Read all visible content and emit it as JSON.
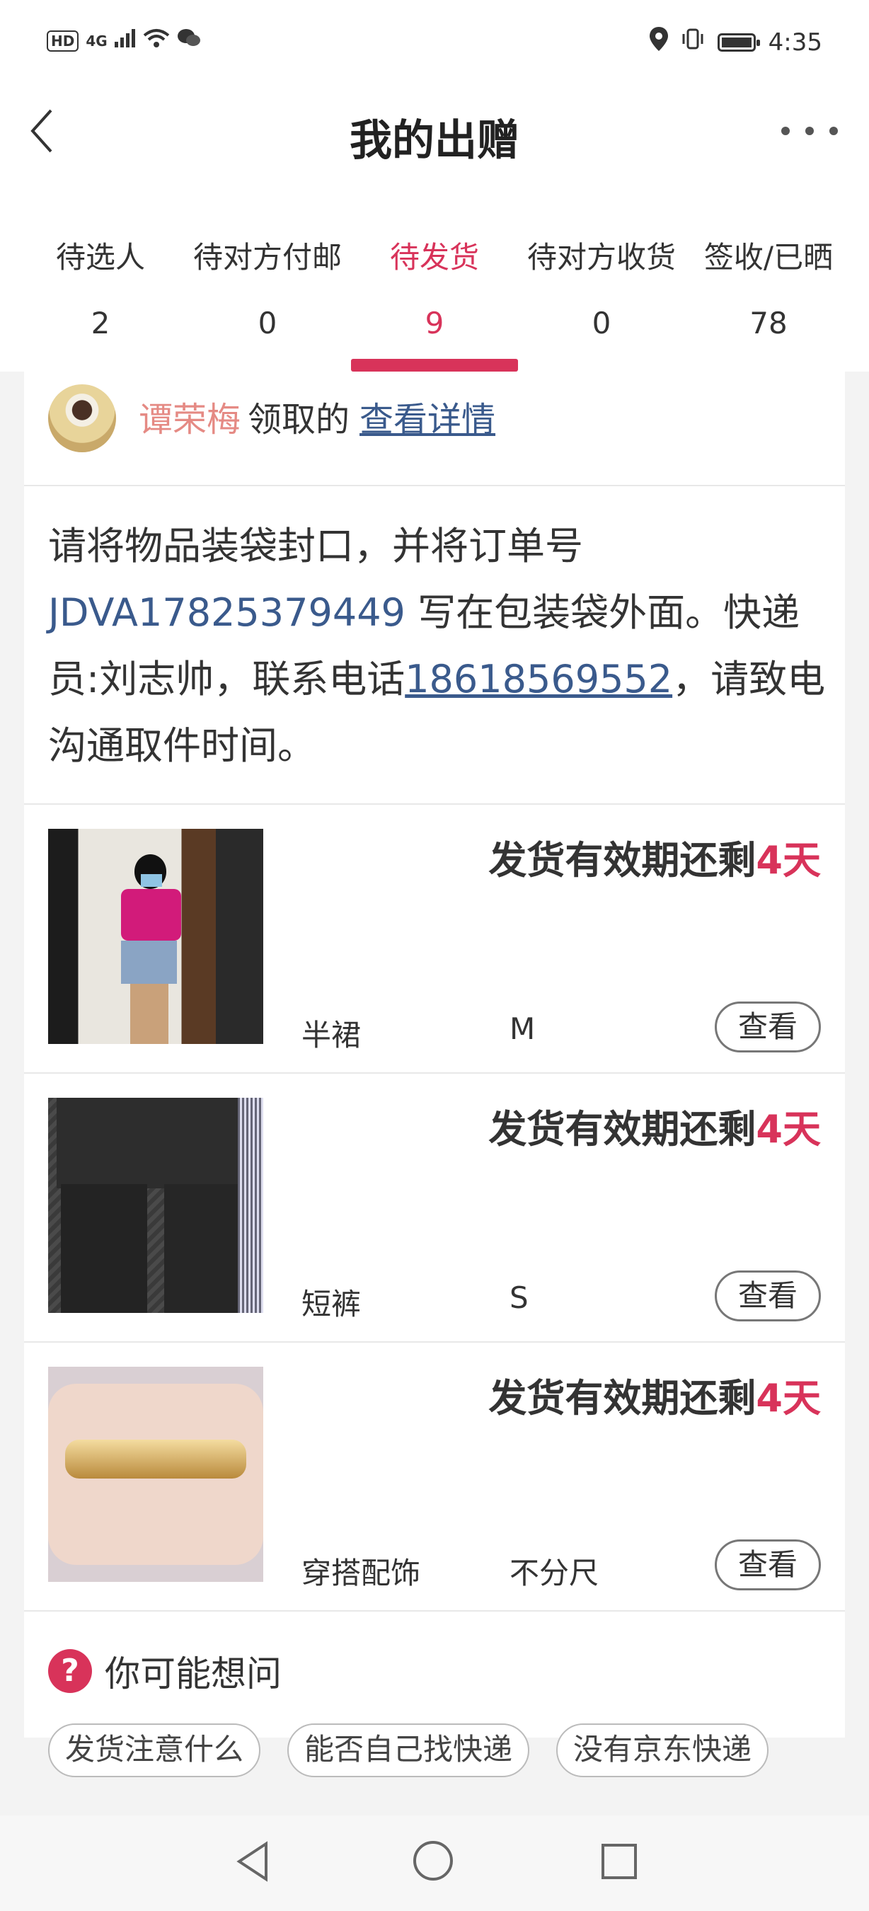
{
  "status_bar": {
    "network_hd": "HD",
    "signal": "4G",
    "time": "4:35",
    "icons": [
      "wifi-icon",
      "wechat-icon",
      "location-icon",
      "vibrate-icon",
      "battery-icon"
    ]
  },
  "header": {
    "title": "我的出赠",
    "back_icon": "chevron-left-icon",
    "more_icon": "more-dots-icon"
  },
  "tabs": [
    {
      "label": "待选人",
      "count": "2",
      "active": false
    },
    {
      "label": "待对方付邮",
      "count": "0",
      "active": false
    },
    {
      "label": "待发货",
      "count": "9",
      "active": true
    },
    {
      "label": "待对方收货",
      "count": "0",
      "active": false
    },
    {
      "label": "签收/已晒",
      "count": "78",
      "active": false
    }
  ],
  "receiver": {
    "name": "谭荣梅",
    "action": "领取的",
    "details_link": "查看详情"
  },
  "instruction": {
    "part1": "请将物品装袋封口，并将订单号 ",
    "order_no": "JDVA17825379449",
    "part2": " 写在包装袋外面。快递员:刘志帅，联系电话",
    "phone": "18618569552",
    "part3": "，请致电沟通取件时间。"
  },
  "items": [
    {
      "deadline_text": "发货有效期还剩",
      "days": "4天",
      "category": "半裙",
      "size": "M",
      "view_label": "查看"
    },
    {
      "deadline_text": "发货有效期还剩",
      "days": "4天",
      "category": "短裤",
      "size": "S",
      "view_label": "查看"
    },
    {
      "deadline_text": "发货有效期还剩",
      "days": "4天",
      "category": "穿搭配饰",
      "size": "不分尺",
      "view_label": "查看"
    }
  ],
  "faq": {
    "icon_text": "?",
    "title": "你可能想问",
    "chips": [
      "发货注意什么",
      "能否自己找快递",
      "没有京东快递"
    ]
  },
  "colors": {
    "accent": "#d8335a",
    "link": "#3a5a8c",
    "receiver_name": "#e58a84"
  }
}
